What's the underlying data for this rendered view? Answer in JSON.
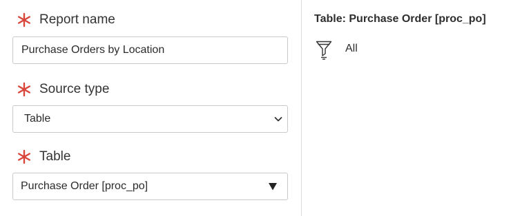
{
  "form": {
    "report_name": {
      "label": "Report name",
      "value": "Purchase Orders by Location",
      "required": true
    },
    "source_type": {
      "label": "Source type",
      "value": "Table",
      "required": true
    },
    "table": {
      "label": "Table",
      "value": "Purchase Order [proc_po]",
      "required": true
    }
  },
  "side_panel": {
    "table_title": "Table: Purchase Order [proc_po]",
    "filter_icon": "funnel-icon",
    "filter_text": "All"
  },
  "colors": {
    "required_asterisk": "#d9453a",
    "border": "#c9c9c9",
    "divider": "#dcdcdc"
  }
}
